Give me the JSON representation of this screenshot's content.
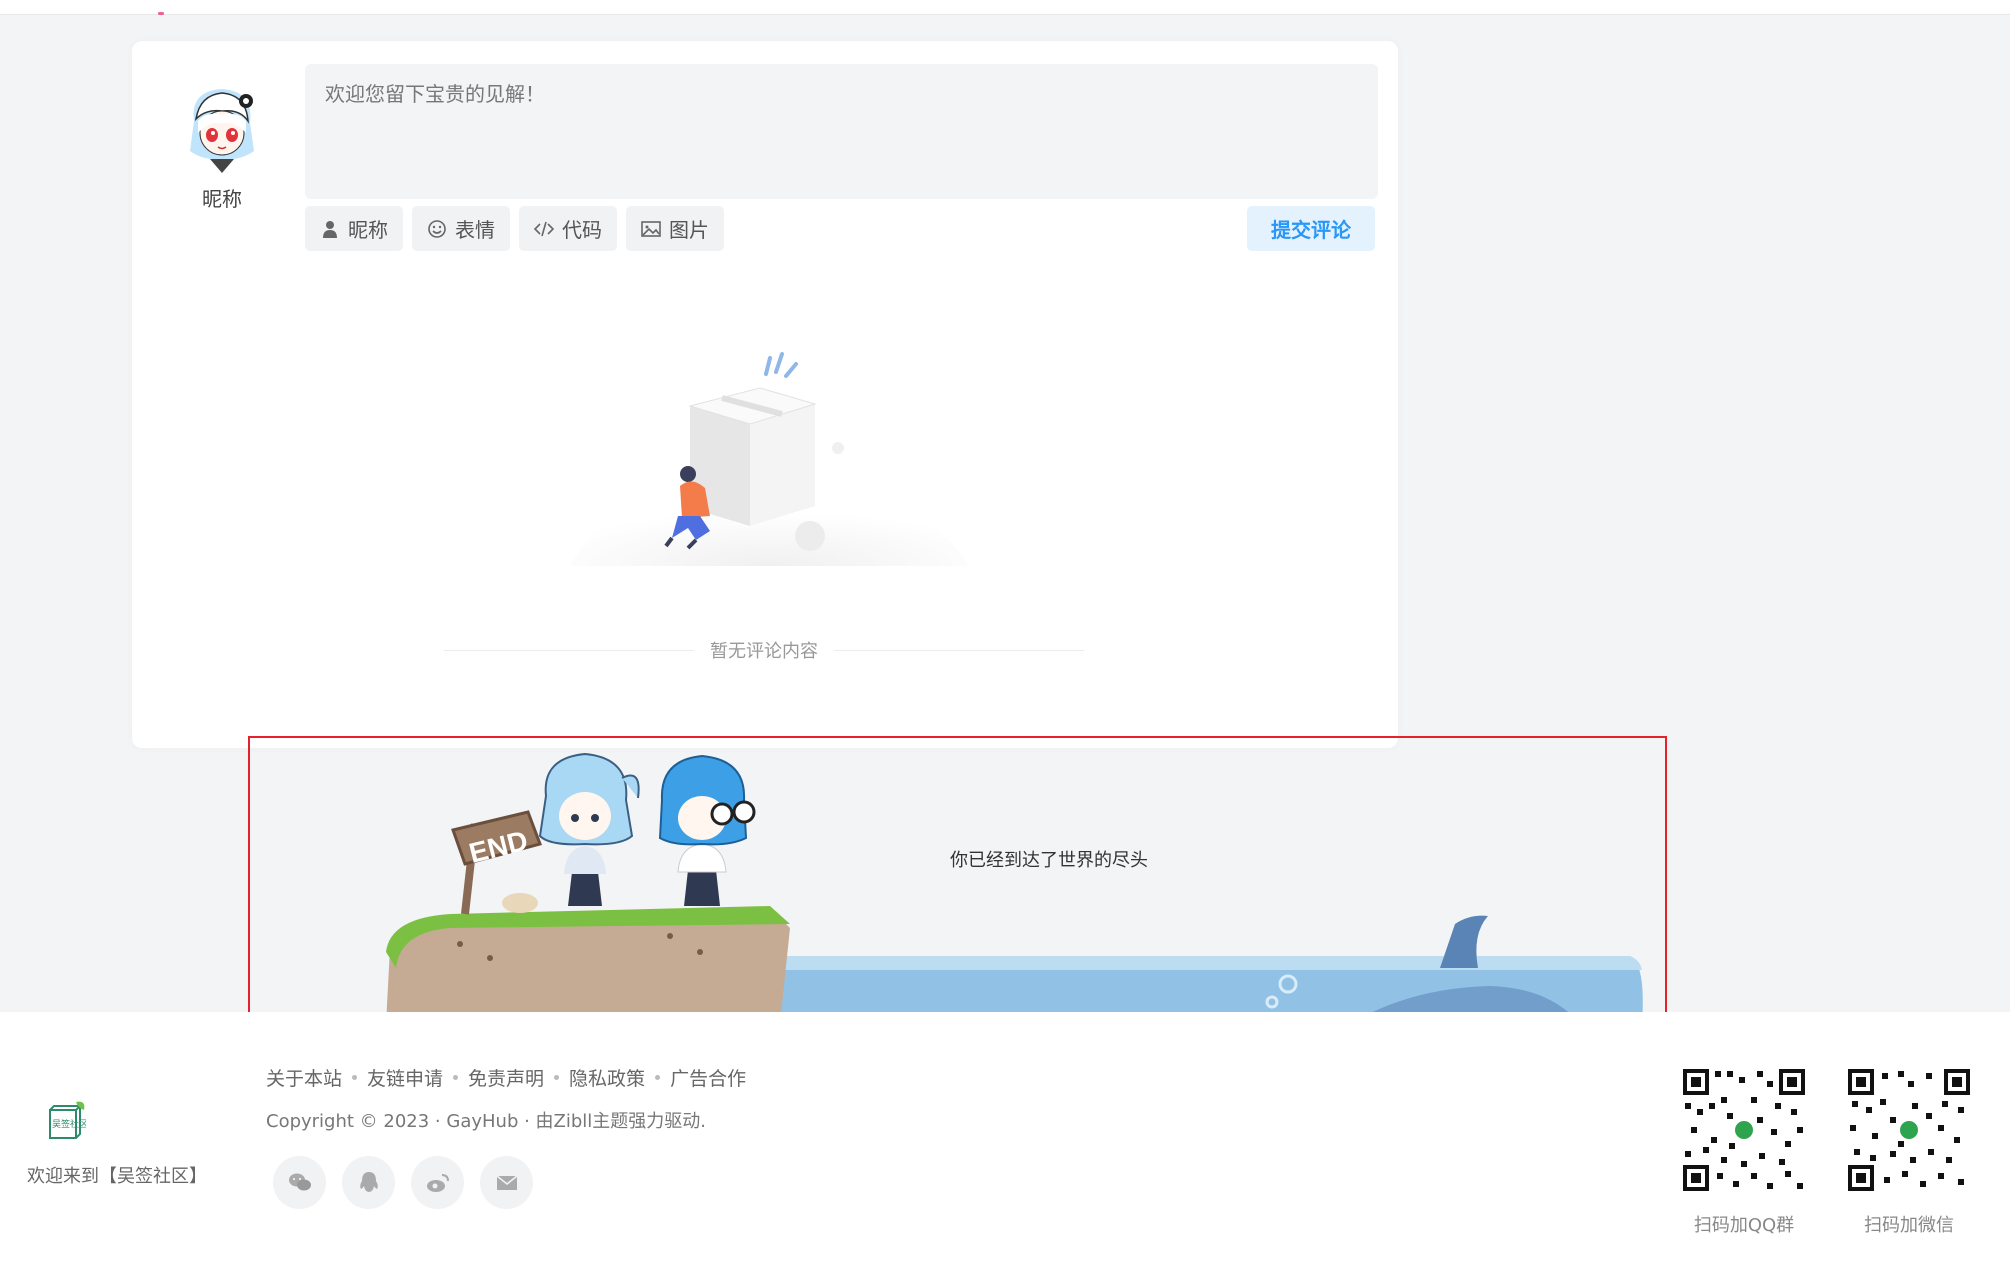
{
  "comment": {
    "nickname_label": "昵称",
    "placeholder": "欢迎您留下宝贵的见解！",
    "tools": [
      {
        "icon": "user-icon",
        "label": "昵称"
      },
      {
        "icon": "smile-icon",
        "label": "表情"
      },
      {
        "icon": "code-icon",
        "label": "代码"
      },
      {
        "icon": "image-icon",
        "label": "图片"
      }
    ],
    "submit_label": "提交评论",
    "empty_text": "暂无评论内容"
  },
  "end_banner": {
    "sign_text": "END",
    "message": "你已经到达了世界的尽头"
  },
  "footer": {
    "logo_text": "吴签社区",
    "welcome": "欢迎来到【吴签社区】",
    "links": [
      "关于本站",
      "友链申请",
      "免责声明",
      "隐私政策",
      "广告合作"
    ],
    "copyright": "Copyright © 2023 · GayHub · 由Zibll主题强力驱动.",
    "social_icons": [
      "wechat-icon",
      "qq-icon",
      "weibo-icon",
      "email-icon"
    ],
    "qr_codes": [
      {
        "caption": "扫码加QQ群"
      },
      {
        "caption": "扫码加微信"
      }
    ]
  },
  "colors": {
    "accent": "#2997f7",
    "highlight_border": "#e5212b",
    "background": "#f3f4f6"
  }
}
